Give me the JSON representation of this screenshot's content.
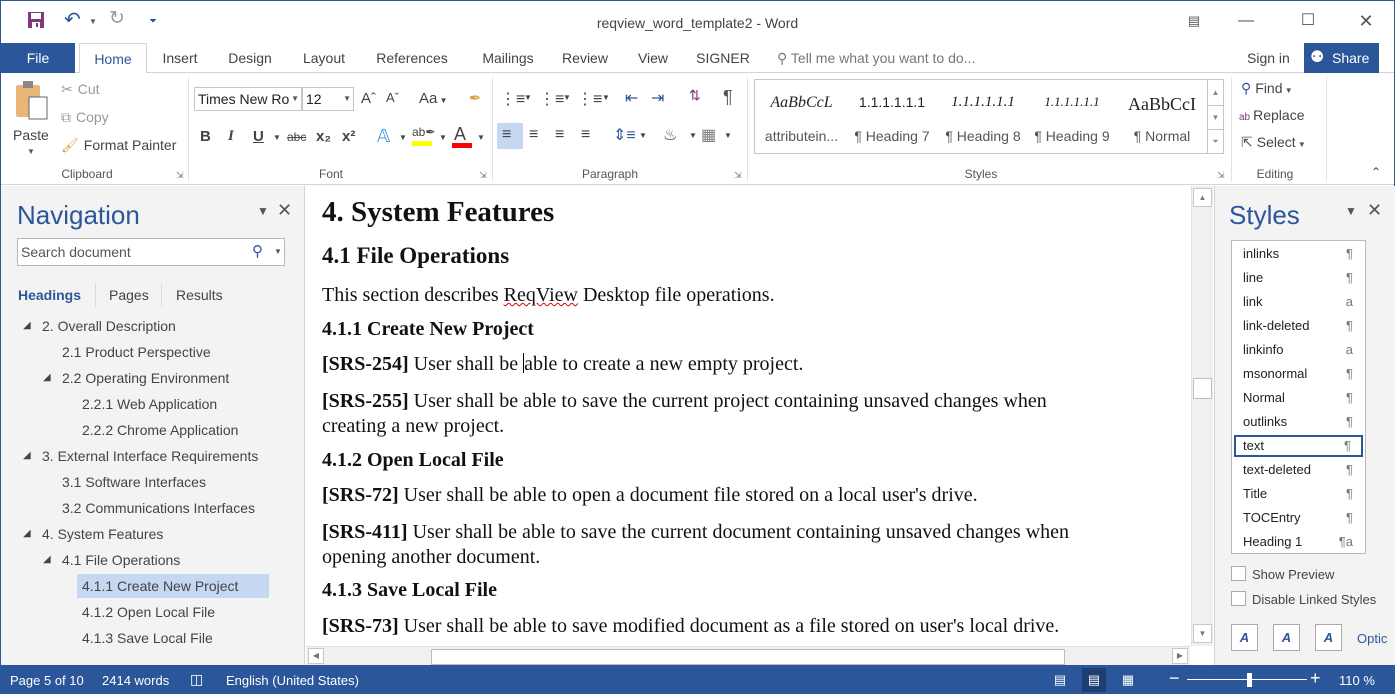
{
  "window": {
    "title": "reqview_word_template2 - Word",
    "qat": {
      "save_icon": "save-icon",
      "undo_icon": "undo-icon",
      "redo_icon": "redo-icon",
      "customize_icon": "customize-qat-icon"
    },
    "controls": {
      "ribbon_display": "ribbon-display-options-icon",
      "minimize": "minimize-icon",
      "maximize": "maximize-icon",
      "close": "close-icon"
    }
  },
  "tabs": {
    "file": "File",
    "items": [
      "Home",
      "Insert",
      "Design",
      "Layout",
      "References",
      "Mailings",
      "Review",
      "View",
      "SIGNER"
    ],
    "active": "Home",
    "tell_me": "Tell me what you want to do...",
    "sign_in": "Sign in",
    "share": "Share"
  },
  "ribbon": {
    "clipboard": {
      "label": "Clipboard",
      "paste": "Paste",
      "cut": "Cut",
      "copy": "Copy",
      "format_painter": "Format Painter"
    },
    "font": {
      "label": "Font",
      "font_name": "Times New Ro",
      "font_size": "12",
      "change_case": "Aa",
      "bold": "B",
      "italic": "I",
      "underline": "U",
      "strikethrough": "abc",
      "subscript": "x₂",
      "superscript": "x²",
      "highlight_color": "#ffff00",
      "font_color": "#ff0000"
    },
    "paragraph": {
      "label": "Paragraph",
      "pilcrow": "¶"
    },
    "styles": {
      "label": "Styles",
      "gallery": [
        {
          "preview": "AaBbCcL",
          "name": "attributein..."
        },
        {
          "preview": "1.1.1.1.1.1",
          "name": "¶ Heading 7"
        },
        {
          "preview": "1.1.1.1.1.1",
          "name": "¶ Heading 8"
        },
        {
          "preview": "1.1.1.1.1.1",
          "name": "¶ Heading 9"
        },
        {
          "preview": "AaBbCcI",
          "name": "¶ Normal"
        }
      ]
    },
    "editing": {
      "label": "Editing",
      "find": "Find",
      "replace": "Replace",
      "select": "Select"
    }
  },
  "navigation": {
    "title": "Navigation",
    "search_placeholder": "Search document",
    "tabs": [
      "Headings",
      "Pages",
      "Results"
    ],
    "active_tab": "Headings",
    "headings": [
      {
        "label": "2. Overall Description",
        "level": 1,
        "expanded": true
      },
      {
        "label": "2.1 Product Perspective",
        "level": 2
      },
      {
        "label": "2.2 Operating Environment",
        "level": 2,
        "expanded": true
      },
      {
        "label": "2.2.1 Web Application",
        "level": 3
      },
      {
        "label": "2.2.2 Chrome Application",
        "level": 3
      },
      {
        "label": "3. External Interface Requirements",
        "level": 1,
        "expanded": true
      },
      {
        "label": "3.1 Software Interfaces",
        "level": 2
      },
      {
        "label": "3.2 Communications Interfaces",
        "level": 2
      },
      {
        "label": "4. System Features",
        "level": 1,
        "expanded": true
      },
      {
        "label": "4.1 File Operations",
        "level": 2,
        "expanded": true
      },
      {
        "label": "4.1.1 Create New Project",
        "level": 3,
        "selected": true
      },
      {
        "label": "4.1.2 Open Local File",
        "level": 3
      },
      {
        "label": "4.1.3 Save Local File",
        "level": 3
      }
    ]
  },
  "document": {
    "h1": "4.  System Features",
    "h2": "4.1  File Operations",
    "intro_before": "This section describes ",
    "intro_misspelled": "ReqView",
    "intro_after": " Desktop file operations.",
    "h3_1": "4.1.1   Create New Project",
    "srs254_id": "[SRS-254]",
    "srs254_a": " User shall be ",
    "srs254_b": "able to create a new empty project.",
    "srs255_id": "[SRS-255]",
    "srs255_l1": " User shall be able to save the current project containing unsaved changes when",
    "srs255_l2": "creating a new project.",
    "h3_2": "4.1.2   Open Local File",
    "srs72_id": "[SRS-72]",
    "srs72_text": " User shall be able to open a document file stored on a local user's drive.",
    "srs411_id": "[SRS-411]",
    "srs411_l1": " User shall be able to save the current document containing unsaved changes when",
    "srs411_l2": "opening another document.",
    "h3_3": "4.1.3   Save Local File",
    "srs73_id": "[SRS-73]",
    "srs73_text": " User shall be able to save modified document as a file stored on user's local drive."
  },
  "styles_pane": {
    "title": "Styles",
    "items": [
      {
        "name": "inlinks",
        "symbol": "¶"
      },
      {
        "name": "line",
        "symbol": "¶"
      },
      {
        "name": "link",
        "symbol": "a"
      },
      {
        "name": "link-deleted",
        "symbol": "¶"
      },
      {
        "name": "linkinfo",
        "symbol": "a"
      },
      {
        "name": "msonormal",
        "symbol": "¶"
      },
      {
        "name": "Normal",
        "symbol": "¶"
      },
      {
        "name": "outlinks",
        "symbol": "¶"
      },
      {
        "name": "text",
        "symbol": "¶",
        "selected": true
      },
      {
        "name": "text-deleted",
        "symbol": "¶"
      },
      {
        "name": "Title",
        "symbol": "¶"
      },
      {
        "name": "TOCEntry",
        "symbol": "¶"
      },
      {
        "name": "Heading 1",
        "symbol": "¶a"
      }
    ],
    "show_preview": {
      "label": "Show Preview",
      "checked": false
    },
    "disable_linked": {
      "label": "Disable Linked Styles",
      "checked": false
    },
    "options_link": "Optic"
  },
  "status": {
    "page": "Page 5 of 10",
    "words": "2414 words",
    "language": "English (United States)",
    "zoom": "110 %",
    "zoom_percent": 110
  }
}
